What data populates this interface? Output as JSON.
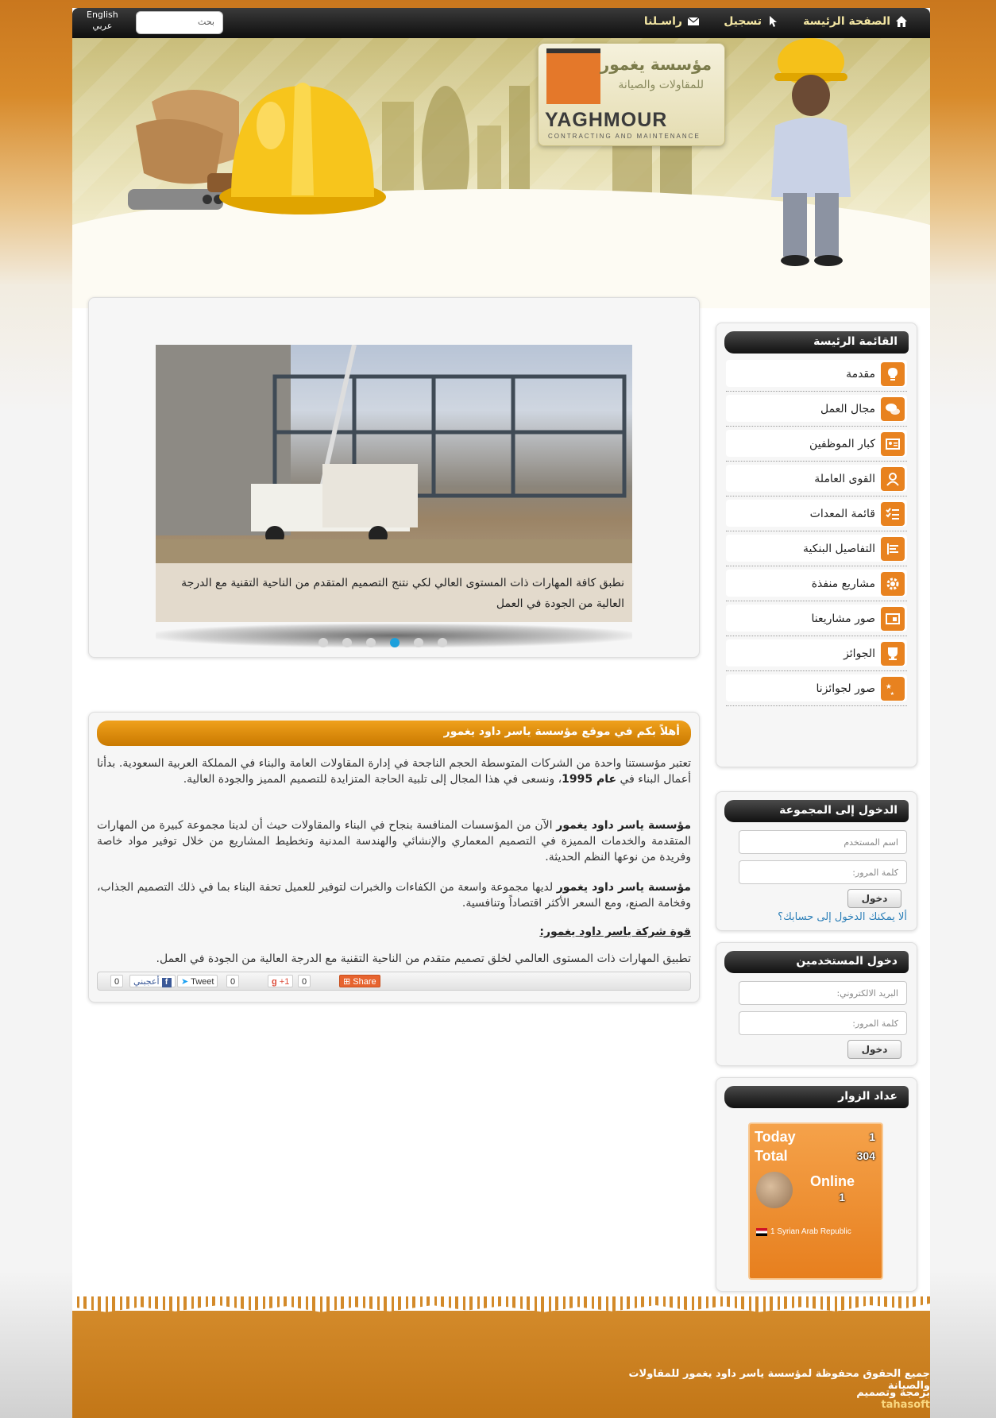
{
  "nav": {
    "home": "الصفحة الرئيسة",
    "register": "تسجيل",
    "contact": "راسـلنا",
    "search_placeholder": "بحث",
    "lang_en": "English",
    "lang_ar": "عربي"
  },
  "header": {
    "logo_ar_line1": "مؤسسة يغمور",
    "logo_ar_line2": "للمقاولات والصيانة",
    "logo_en": "YAGHMOUR",
    "logo_en_sub": "CONTRACTING AND MAINTENANCE"
  },
  "slider": {
    "caption": "نطبق كافة المهارات ذات المستوى العالي لكي نتنج التصميم المتقدم من الناحية التقنية مع الدرجة العالية من الجودة في العمل",
    "dots": 6,
    "active_dot": 4
  },
  "article": {
    "title": "أهلاً بكم في موقع مؤسسة ياسر داود يغمور",
    "p1_a": "تعتبر مؤسستنا واحدة من الشركات المتوسطة الحجم الناجحة في إدارة المقاولات العامة والبناء في المملكة العربية السعودية. بدأنا أعمال البناء في ",
    "p1_b": "عام 1995",
    "p1_c": "، ونسعى في هذا المجال إلى تلبية الحاجة المتزايدة للتصميم المميز والجودة العالية.",
    "p2_a": "مؤسسة ياسر داود يغمور",
    "p2_b": " الآن من المؤسسات المنافسة بنجاح في البناء والمقاولات حيث أن لدينا مجموعة كبيرة من المهارات المتقدمة والخدمات المميزة في التصميم المعماري والإنشائي والهندسة المدنية وتخطيط المشاريع من خلال توفير مواد خاصة وفريدة من نوعها النظم الحديثة.",
    "p3_a": "مؤسسة ياسر داود يغمور",
    "p3_b": "  لديها مجموعة واسعة من الكفاءات والخبرات  لتوفير للعميل تحفة البناء بما في ذلك التصميم الجذاب، وفخامة الصنع، ومع السعر الأكثر اقتصاداً وتنافسية.",
    "p4": "قوة شركة ياسر داود يغمور:",
    "p5": "تطبيق المهارات ذات المستوى العالمي لخلق تصميم متقدم من الناحية التقنية مع الدرجة العالية من الجودة في العمل."
  },
  "share": {
    "fb_count": "0",
    "fb_label": "أعجبني",
    "tweet_label": "Tweet",
    "tweet_count": "0",
    "gplus_label": "+1",
    "gplus_count": "0",
    "share_label": "Share"
  },
  "sidebar": {
    "main_menu_title": "القائمة الرئيسة",
    "menu_items": [
      {
        "label": "مقدمة",
        "icon": "lightbulb-icon"
      },
      {
        "label": "مجال العمل",
        "icon": "chat-bubbles-icon"
      },
      {
        "label": "كبار الموظفين",
        "icon": "id-card-icon"
      },
      {
        "label": "القوى العاملة",
        "icon": "users-icon"
      },
      {
        "label": "قائمة المعدات",
        "icon": "checklist-icon"
      },
      {
        "label": "التفاصيل البنكية",
        "icon": "bars-icon"
      },
      {
        "label": "مشاريع منفذة",
        "icon": "gear-icon"
      },
      {
        "label": "صور مشاريعنا",
        "icon": "picture-icon"
      },
      {
        "label": "الجوائز",
        "icon": "award-icon"
      },
      {
        "label": "صور لجوائزنا",
        "icon": "stars-icon"
      }
    ],
    "group_login": {
      "title": "الدخول إلى المجموعة",
      "username_placeholder": "اسم المستخدم",
      "password_placeholder": "كلمة المرور:",
      "button": "دخول",
      "forgot": "ألا يمكنك الدخول إلى حسابك؟"
    },
    "user_login": {
      "title": "دخول المستخدمين",
      "email_placeholder": "البريد الالكتروني:",
      "password_placeholder": "كلمة المرور:",
      "button": "دخول"
    },
    "visitors": {
      "title": "عداد الزوار",
      "today_label": "Today",
      "today_value": "1",
      "total_label": "Total",
      "total_value": "304",
      "online_label": "Online",
      "online_value": "1",
      "country": "1 Syrian Arab Republic"
    }
  },
  "footer": {
    "line1": "جميع الحقوق محفوظة لمؤسسة ياسر داود يغمور للمقاولات والصيانة",
    "line2_prefix": "برمجة وتصميم",
    "line2_brand": "tahasoft"
  },
  "colors": {
    "accent_orange": "#e8821f",
    "topbar_dark": "#111111",
    "active_dot": "#1ca0dc"
  }
}
